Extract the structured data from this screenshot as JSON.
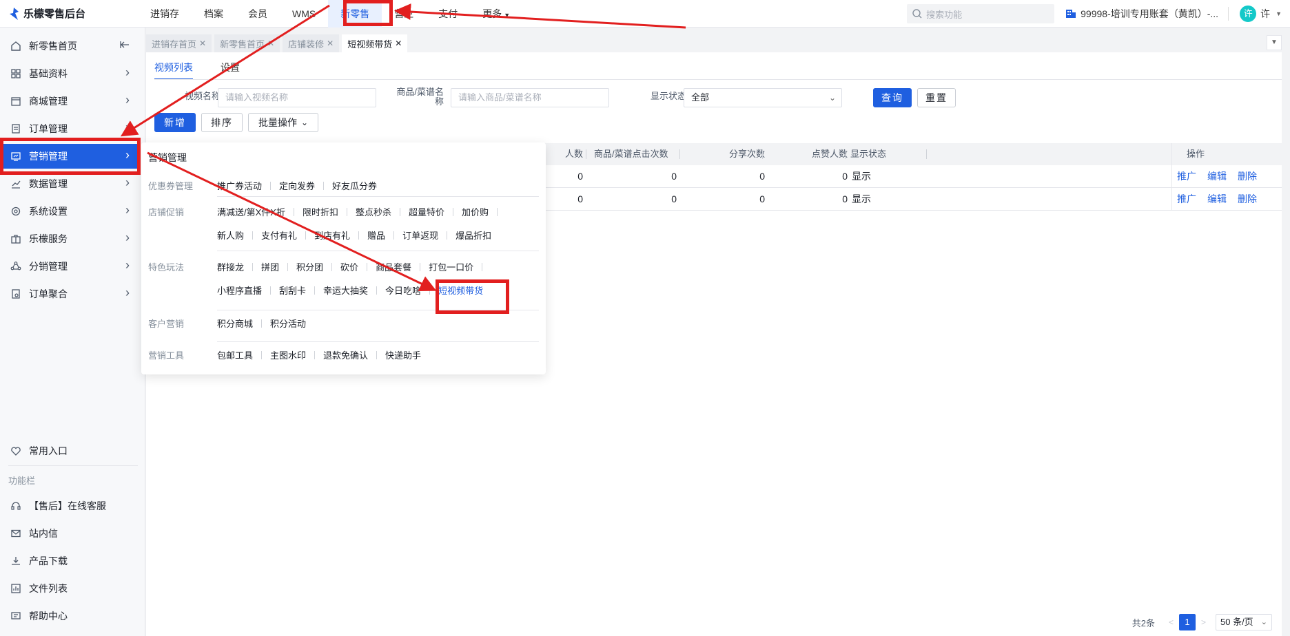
{
  "header": {
    "app_title": "乐檬零售后台",
    "nav": [
      "进销存",
      "档案",
      "会员",
      "WMS",
      "新零售",
      "营业",
      "支付",
      "更多"
    ],
    "active_nav": "新零售",
    "search_placeholder": "搜索功能",
    "account": "99998-培训专用账套（黄凯）-...",
    "avatar_char": "许",
    "user_name": "许"
  },
  "sidebar": {
    "items": [
      {
        "label": "新零售首页"
      },
      {
        "label": "基础资料"
      },
      {
        "label": "商城管理"
      },
      {
        "label": "订单管理"
      },
      {
        "label": "营销管理"
      },
      {
        "label": "数据管理"
      },
      {
        "label": "系统设置"
      },
      {
        "label": "乐檬服务"
      },
      {
        "label": "分销管理"
      },
      {
        "label": "订单聚合"
      }
    ],
    "common_entry": "常用入口",
    "function_bar": "功能栏",
    "bottom_items": [
      {
        "label": "【售后】在线客服"
      },
      {
        "label": "站内信"
      },
      {
        "label": "产品下载"
      },
      {
        "label": "文件列表"
      },
      {
        "label": "帮助中心"
      }
    ]
  },
  "tabs": [
    {
      "label": "进销存首页"
    },
    {
      "label": "新零售首页"
    },
    {
      "label": "店铺装修"
    },
    {
      "label": "短视频带货"
    }
  ],
  "subtabs": [
    "视频列表",
    "设置"
  ],
  "filters": {
    "video_name_label": "视频名称",
    "video_name_placeholder": "请输入视频名称",
    "product_label": "商品/菜谱名称",
    "product_placeholder": "请输入商品/菜谱名称",
    "status_label": "显示状态",
    "status_value": "全部",
    "query_button": "查询",
    "reset_button": "重置"
  },
  "actions": {
    "add": "新增",
    "sort": "排序",
    "batch": "批量操作"
  },
  "table": {
    "columns": [
      "人数",
      "商品/菜谱点击次数",
      "分享次数",
      "点赞人数",
      "显示状态",
      "操作"
    ],
    "rows": [
      {
        "people": "0",
        "clicks": "0",
        "shares": "0",
        "likes": "0",
        "status": "显示"
      },
      {
        "people": "0",
        "clicks": "0",
        "shares": "0",
        "likes": "0",
        "status": "显示"
      }
    ],
    "ops": [
      "推广",
      "编辑",
      "删除"
    ]
  },
  "pagination": {
    "total": "共2条",
    "current": "1",
    "page_size": "50 条/页"
  },
  "menu": {
    "title": "营销管理",
    "groups": [
      {
        "label": "优惠券管理",
        "rows": [
          [
            "推广券活动",
            "定向发券",
            "好友瓜分券"
          ]
        ]
      },
      {
        "label": "店铺促销",
        "rows": [
          [
            "满减送/第X件X折",
            "限时折扣",
            "整点秒杀",
            "超量特价",
            "加价购"
          ],
          [
            "新人购",
            "支付有礼",
            "到店有礼",
            "赠品",
            "订单返现",
            "爆品折扣"
          ]
        ]
      },
      {
        "label": "特色玩法",
        "rows": [
          [
            "群接龙",
            "拼团",
            "积分团",
            "砍价",
            "商品套餐",
            "打包一口价"
          ],
          [
            "小程序直播",
            "刮刮卡",
            "幸运大抽奖",
            "今日吃啥",
            "短视频带货"
          ]
        ]
      },
      {
        "label": "客户营销",
        "rows": [
          [
            "积分商城",
            "积分活动"
          ]
        ]
      },
      {
        "label": "营销工具",
        "rows": [
          [
            "包邮工具",
            "主图水印",
            "退款免确认",
            "快递助手"
          ]
        ]
      }
    ]
  },
  "colors": {
    "accent": "#1f5fe0",
    "annotation": "#e21f1f"
  }
}
